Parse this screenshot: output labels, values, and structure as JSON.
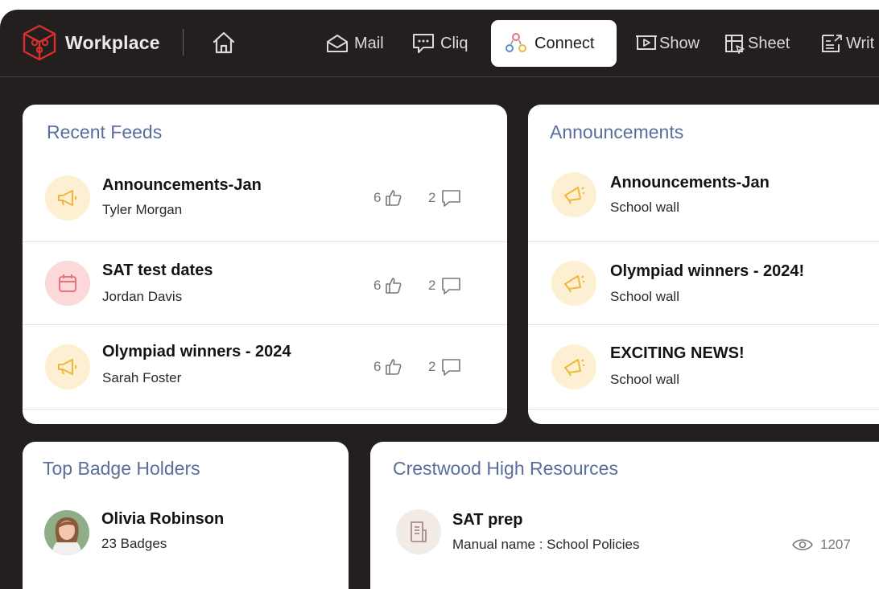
{
  "header": {
    "brand": "Workplace",
    "nav": [
      {
        "label": "Mail",
        "icon": "mail-icon"
      },
      {
        "label": "Cliq",
        "icon": "chat-icon"
      },
      {
        "label": "Connect",
        "icon": "connect-icon",
        "active": true
      },
      {
        "label": "Show",
        "icon": "presentation-icon"
      },
      {
        "label": "Sheet",
        "icon": "spreadsheet-icon"
      },
      {
        "label": "Writ",
        "icon": "writer-icon"
      }
    ]
  },
  "recent_feeds": {
    "title": "Recent Feeds",
    "items": [
      {
        "title": "Announcements-Jan",
        "author": "Tyler Morgan",
        "likes": "6",
        "comments": "2",
        "icon": "megaphone-icon"
      },
      {
        "title": "SAT test dates",
        "author": "Jordan Davis",
        "likes": "6",
        "comments": "2",
        "icon": "calendar-icon"
      },
      {
        "title": "Olympiad winners - 2024",
        "author": "Sarah Foster",
        "likes": "6",
        "comments": "2",
        "icon": "megaphone-icon"
      }
    ]
  },
  "announcements": {
    "title": "Announcements",
    "items": [
      {
        "title": "Announcements-Jan",
        "source": "School wall"
      },
      {
        "title": "Olympiad winners - 2024!",
        "source": "School wall"
      },
      {
        "title": "EXCITING NEWS!",
        "source": "School wall"
      }
    ]
  },
  "badges": {
    "title": "Top Badge Holders",
    "items": [
      {
        "name": "Olivia Robinson",
        "count": "23 Badges"
      }
    ]
  },
  "resources": {
    "title": "Crestwood High Resources",
    "items": [
      {
        "title": "SAT prep",
        "manual": "Manual name : School Policies",
        "views": "1207"
      }
    ]
  },
  "colors": {
    "accent_title": "#5a6e9c",
    "megaphone": "#f0b63a",
    "calendar": "#e8737a",
    "brand_red": "#d9302f"
  }
}
